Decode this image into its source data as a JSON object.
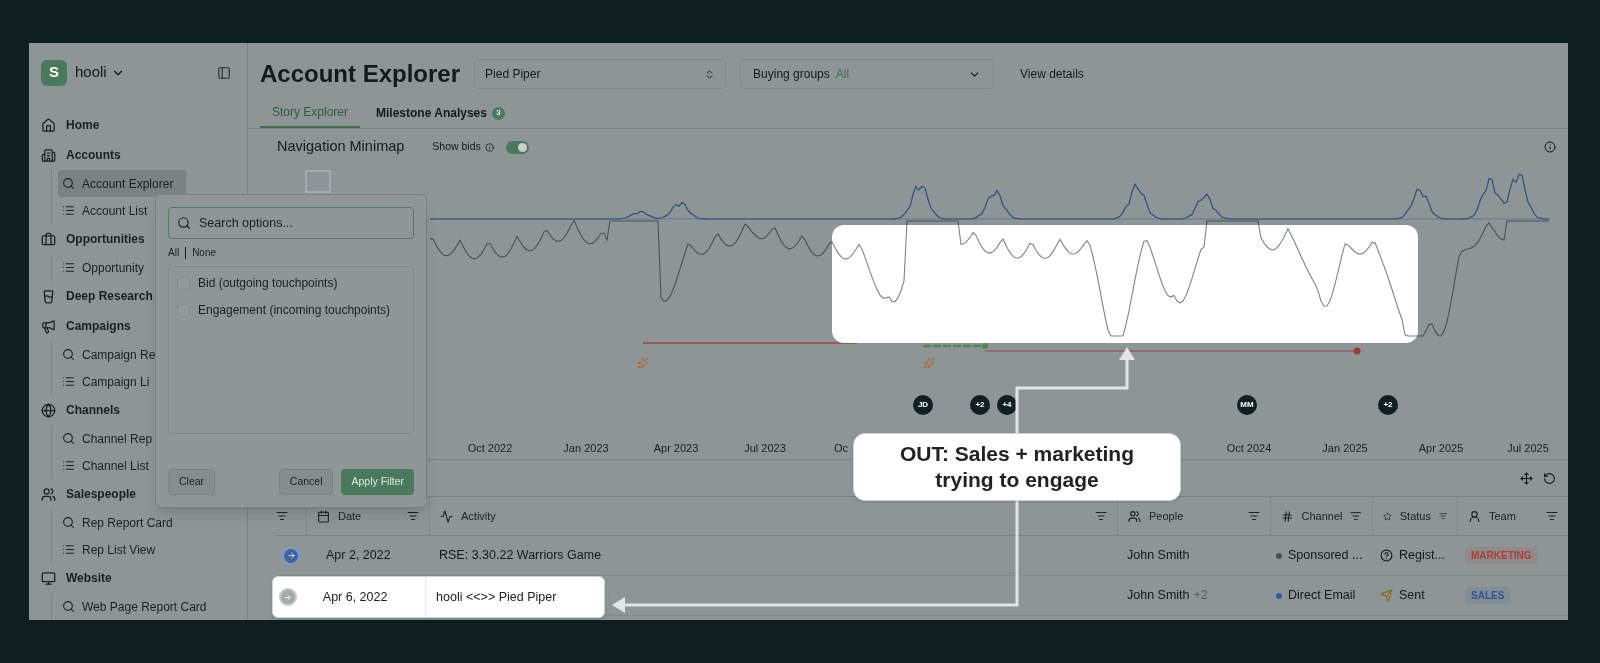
{
  "sidebar": {
    "logo": "S",
    "workspace": "hooli",
    "items": [
      {
        "label": "Home",
        "selected": false
      },
      {
        "label": "Accounts",
        "selected": false,
        "children": [
          {
            "label": "Account Explorer",
            "selected": true
          },
          {
            "label": "Account List",
            "selected": false
          }
        ]
      },
      {
        "label": "Opportunities",
        "selected": false,
        "children": [
          {
            "label": "Opportunity",
            "selected": false
          }
        ]
      },
      {
        "label": "Deep Research",
        "selected": false
      },
      {
        "label": "Campaigns",
        "selected": false,
        "children": [
          {
            "label": "Campaign Re",
            "selected": false
          },
          {
            "label": "Campaign Li",
            "selected": false
          }
        ]
      },
      {
        "label": "Channels",
        "selected": false,
        "children": [
          {
            "label": "Channel Rep",
            "selected": false
          },
          {
            "label": "Channel List",
            "selected": false
          }
        ]
      },
      {
        "label": "Salespeople",
        "selected": false,
        "children": [
          {
            "label": "Rep Report Card",
            "selected": false
          },
          {
            "label": "Rep List View",
            "selected": false
          }
        ]
      },
      {
        "label": "Website",
        "selected": false,
        "children": [
          {
            "label": "Web Page Report Card",
            "selected": false
          }
        ]
      }
    ]
  },
  "header": {
    "title": "Account Explorer",
    "account_select": "Pied Piper",
    "buying_groups": {
      "label": "Buying groups",
      "value": "All"
    },
    "link": "View details"
  },
  "tabs": [
    {
      "label": "Story Explorer",
      "selected": true
    },
    {
      "label": "Milestone Analyses",
      "badge": "3",
      "selected": false
    }
  ],
  "minimap": {
    "title": "Navigation Minimap",
    "toggle": {
      "label": "Show bids",
      "on": true
    },
    "x_labels": [
      "Oct 2022",
      "Jan 2023",
      "Apr 2023",
      "Jul 2023",
      "Oc",
      "Oct 2024",
      "Jan 2025",
      "Apr 2025",
      "Jul 2025"
    ],
    "avatars": [
      "JD",
      "+2",
      "+4",
      "MM",
      "+2"
    ]
  },
  "filter_popup": {
    "search": {
      "placeholder": "Search options..."
    },
    "select_all": "All",
    "select_none": "None",
    "options": [
      {
        "label": "Bid (outgoing touchpoints)",
        "checked": false
      },
      {
        "label": "Engagement (incoming touchpoints)",
        "checked": false
      }
    ],
    "buttons": [
      "Clear",
      "Cancel",
      "Apply Filter"
    ]
  },
  "table": {
    "columns": [
      "Date",
      "Activity",
      "People",
      "Channel",
      "Status",
      "Team"
    ],
    "rows": [
      {
        "selected": true,
        "highlighted": false,
        "date": "Apr 2, 2022",
        "activity": "RSE: 3.30.22 Warriors Game",
        "people": "John Smith",
        "channel": {
          "label": "Sponsored ...",
          "color": "#4a4f52"
        },
        "status": {
          "kind": "pending",
          "label": "Regist..."
        },
        "team": {
          "label": "MARKETING",
          "color": "#a8403d"
        }
      },
      {
        "selected": false,
        "highlighted": true,
        "date": "Apr 6, 2022",
        "activity": "hooli <<>> Pied Piper",
        "people": "John Smith",
        "people_extra": "+2",
        "channel": {
          "label": "Direct Email",
          "color": "#2f5aa8"
        },
        "status": {
          "kind": "sent",
          "label": "Sent"
        },
        "team": {
          "label": "SALES",
          "color": "#34558a"
        }
      }
    ]
  },
  "annotation": {
    "callout": "OUT: Sales + marketing trying to engage"
  }
}
